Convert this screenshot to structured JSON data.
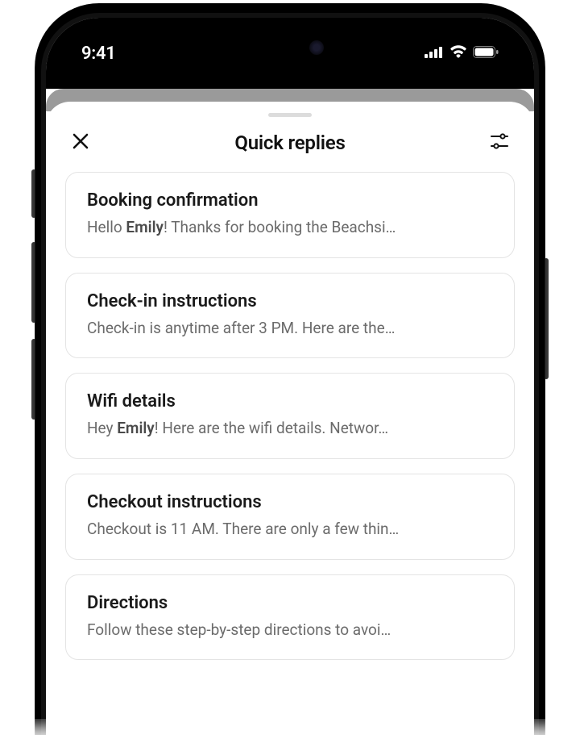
{
  "status": {
    "time": "9:41"
  },
  "header": {
    "title": "Quick replies"
  },
  "cards": [
    {
      "title": "Booking confirmation",
      "preview_pre": "Hello ",
      "preview_bold": "Emily",
      "preview_post": "! Thanks for booking the Beachsi…"
    },
    {
      "title": "Check-in instructions",
      "preview_pre": "Check-in is anytime after 3 PM. Here are the…",
      "preview_bold": "",
      "preview_post": ""
    },
    {
      "title": "Wifi details",
      "preview_pre": "Hey ",
      "preview_bold": "Emily",
      "preview_post": "! Here are the wifi details. Networ…"
    },
    {
      "title": "Checkout instructions",
      "preview_pre": "Checkout is 11 AM. There are only a few thin…",
      "preview_bold": "",
      "preview_post": ""
    },
    {
      "title": "Directions",
      "preview_pre": "Follow these step-by-step directions to avoi…",
      "preview_bold": "",
      "preview_post": ""
    }
  ]
}
